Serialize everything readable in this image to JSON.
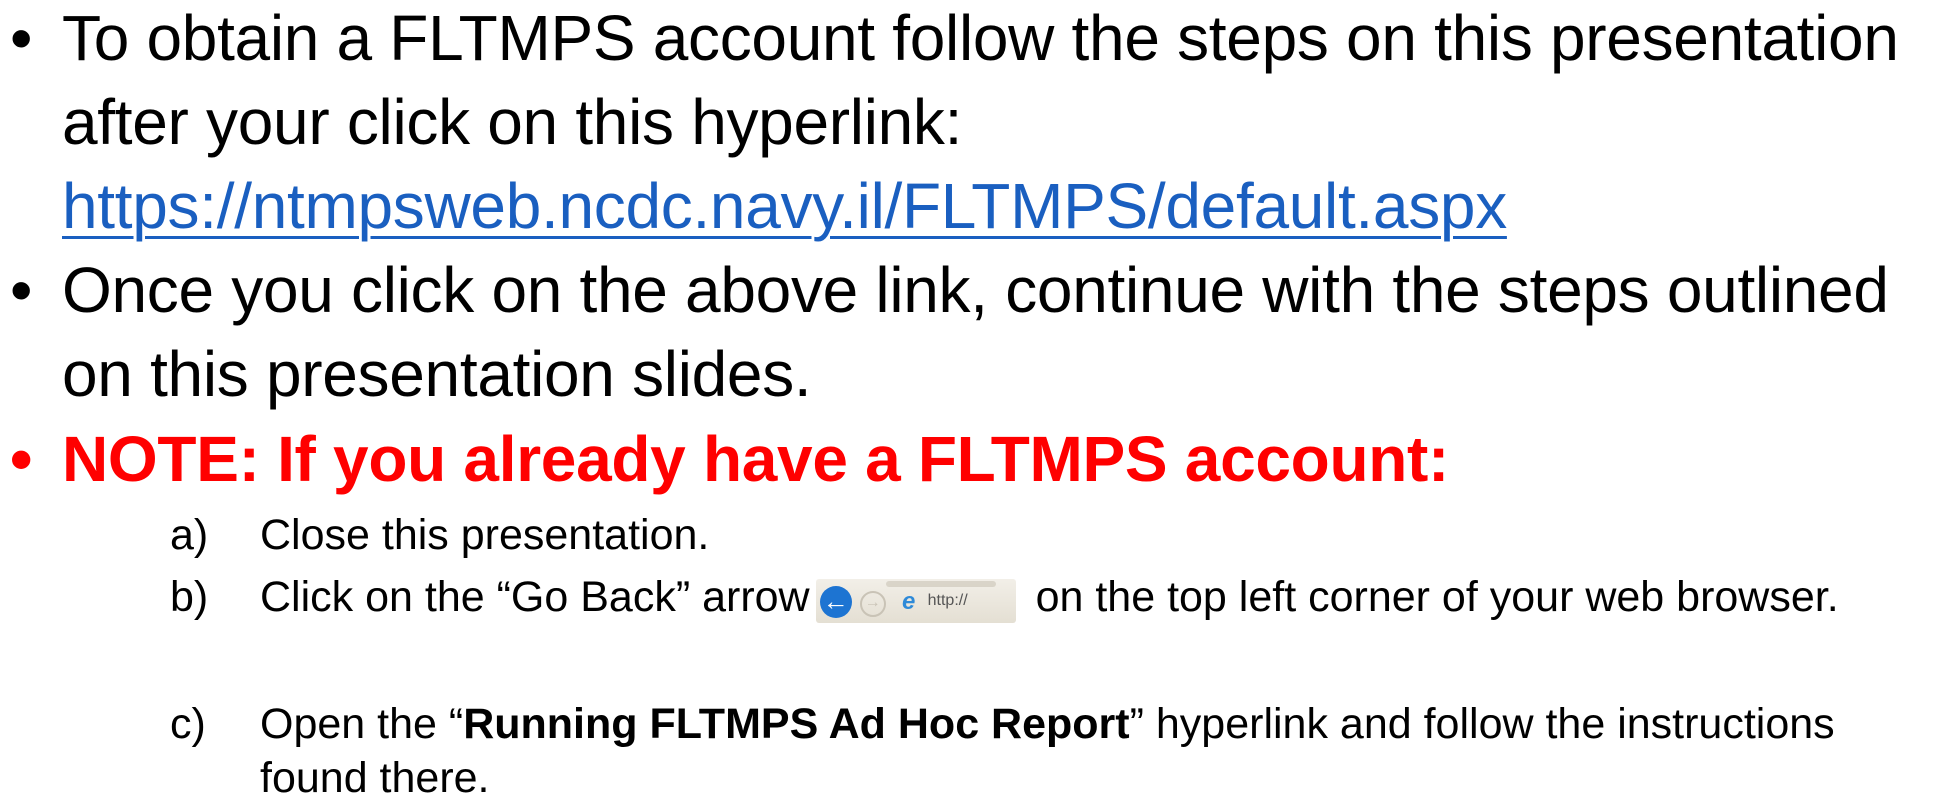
{
  "bullets": {
    "bullet_glyph": "•",
    "b1": {
      "line1": "To obtain a FLTMPS account follow the steps on this presentation",
      "line2": "after your click on this hyperlink:",
      "link": "https://ntmpsweb.ncdc.navy.il/FLTMPS/default.aspx"
    },
    "b2": {
      "text": "Once you click on the above link, continue with the steps outlined on this presentation slides."
    },
    "note": {
      "text": "NOTE:  If you already have a FLTMPS account:"
    }
  },
  "steps": [
    {
      "letter": "a)",
      "text": " Close this presentation."
    },
    {
      "letter": "b)",
      "before": "Click on the “Go Back” arrow",
      "after": " on the top left corner of your web browser.",
      "browser_image": {
        "url_hint": "http://",
        "icons": [
          "back-arrow-icon",
          "forward-arrow-icon",
          "ie-browser-icon"
        ]
      }
    },
    {
      "letter": "c)",
      "pre": "Open the “",
      "bold": "Running FLTMPS Ad Hoc Report",
      "post": "” hyperlink and follow the instructions found there."
    }
  ],
  "colors": {
    "link": "#1a5fc0",
    "note": "#ff0000",
    "back_button": "#1d74d2"
  }
}
